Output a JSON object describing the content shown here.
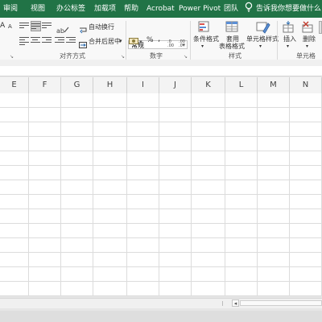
{
  "menu": {
    "tabs": [
      "审阅",
      "视图",
      "办公标签",
      "加载项",
      "帮助",
      "Acrobat",
      "Power Pivot",
      "团队"
    ],
    "tell_me": "告诉我你想要做什么"
  },
  "ribbon": {
    "font_size_up": "A",
    "font_size_down": "A",
    "wrap_text": "自动换行",
    "merge_center": "合并后居中",
    "number_format": "常规",
    "percent": "%",
    "comma": ",",
    "conditional_format": "条件格式",
    "format_as_table_line1": "套用",
    "format_as_table_line2": "表格格式",
    "cell_styles": "单元格样式",
    "insert": "插入",
    "delete": "删除",
    "groups": {
      "alignment": "对齐方式",
      "number": "数字",
      "styles": "样式",
      "cells": "单元格"
    }
  },
  "grid": {
    "columns": [
      "E",
      "F",
      "G",
      "H",
      "I",
      "J",
      "K",
      "L",
      "M",
      "N"
    ]
  },
  "colors": {
    "menu_bg": "#217346",
    "ribbon_bg": "#f8f8f8",
    "grid_line": "#dcdcdc"
  }
}
